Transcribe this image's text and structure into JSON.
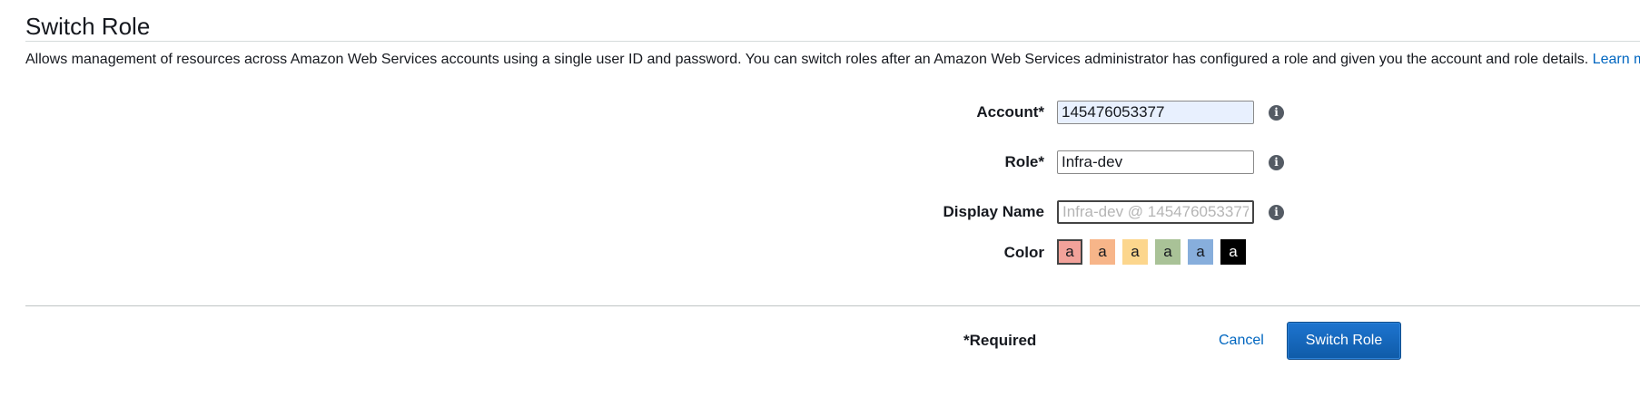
{
  "header": {
    "title": "Switch Role"
  },
  "description": {
    "text": "Allows management of resources across Amazon Web Services accounts using a single user ID and password. You can switch roles after an Amazon Web Services administrator has configured a role and given you the account and role details.",
    "learn_more_link": "Learn more."
  },
  "form": {
    "account": {
      "label": "Account*",
      "value": "145476053377",
      "info_icon": "info-icon"
    },
    "role": {
      "label": "Role*",
      "value": "Infra-dev",
      "info_icon": "info-icon"
    },
    "display_name": {
      "label": "Display Name",
      "value": "",
      "placeholder": "Infra-dev @ 145476053377",
      "info_icon": "info-icon"
    },
    "color": {
      "label": "Color",
      "selected_index": 0,
      "swatches": [
        {
          "glyph": "a",
          "color": "#f2a29a",
          "text_color": "#16191f"
        },
        {
          "glyph": "a",
          "color": "#f7b589",
          "text_color": "#16191f"
        },
        {
          "glyph": "a",
          "color": "#fcd68d",
          "text_color": "#16191f"
        },
        {
          "glyph": "a",
          "color": "#a9c297",
          "text_color": "#16191f"
        },
        {
          "glyph": "a",
          "color": "#87aedc",
          "text_color": "#16191f"
        },
        {
          "glyph": "a",
          "color": "#000000",
          "text_color": "#ffffff"
        }
      ]
    }
  },
  "footer": {
    "required_note": "*Required",
    "cancel_label": "Cancel",
    "submit_label": "Switch Role"
  },
  "colors": {
    "link": "#0066c0",
    "primary_button": "#1d74cf",
    "info_icon": "#545b64"
  }
}
